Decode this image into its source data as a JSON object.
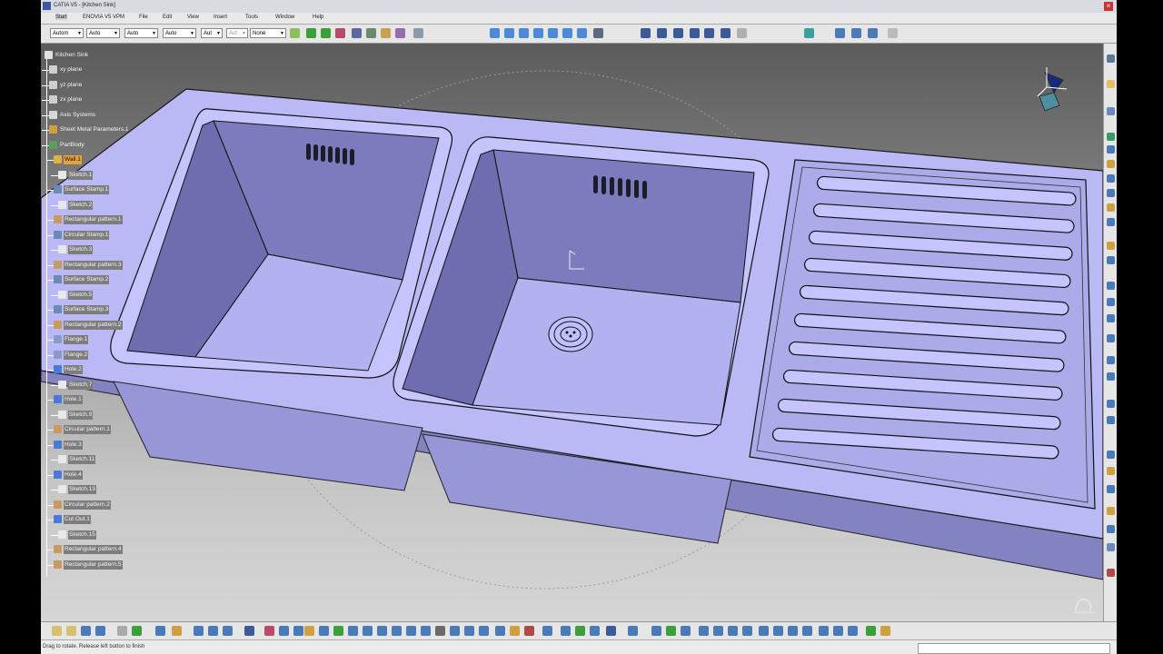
{
  "window": {
    "title": "CATIA V5 - [Kitchen Sink]"
  },
  "menu": {
    "items": [
      "Start",
      "ENOVIA V5 VPM",
      "File",
      "Edit",
      "View",
      "Insert",
      "Tools",
      "Window",
      "Help"
    ]
  },
  "toolbar": {
    "dropdowns": [
      "Autom",
      "Auto",
      "Auto",
      "Auto",
      "Aut",
      "Aut",
      "None"
    ]
  },
  "tree": {
    "root": "Kitchen Sink",
    "items": [
      {
        "label": "xy plane",
        "icon": "plane-icon",
        "style": "plain"
      },
      {
        "label": "yz plane",
        "icon": "plane-icon",
        "style": "plain"
      },
      {
        "label": "zx plane",
        "icon": "plane-icon",
        "style": "plain"
      },
      {
        "label": "Axis Systems",
        "icon": "axis-system-icon",
        "style": "plain"
      },
      {
        "label": "Sheet Metal Parameters.1",
        "icon": "sheet-metal-parameters-icon",
        "style": "plain"
      },
      {
        "label": "PartBody",
        "icon": "partbody-icon",
        "style": "plain"
      },
      {
        "label": "Wall.1",
        "icon": "wall-icon",
        "style": "highlight"
      },
      {
        "label": "Sketch.1",
        "icon": "sketch-icon",
        "style": "box"
      },
      {
        "label": "Surface Stamp.1",
        "icon": "surface-stamp-icon",
        "style": "box"
      },
      {
        "label": "Sketch.2",
        "icon": "sketch-icon",
        "style": "box"
      },
      {
        "label": "Rectangular pattern.1",
        "icon": "rectangular-pattern-icon",
        "style": "box"
      },
      {
        "label": "Circular Stamp.1",
        "icon": "circular-stamp-icon",
        "style": "box"
      },
      {
        "label": "Sketch.3",
        "icon": "sketch-icon",
        "style": "box"
      },
      {
        "label": "Rectangular pattern.3",
        "icon": "rectangular-pattern-icon",
        "style": "box"
      },
      {
        "label": "Surface Stamp.2",
        "icon": "surface-stamp-icon",
        "style": "box"
      },
      {
        "label": "Sketch.5",
        "icon": "sketch-icon",
        "style": "box"
      },
      {
        "label": "Surface Stamp.3",
        "icon": "surface-stamp-icon",
        "style": "box"
      },
      {
        "label": "Rectangular pattern.2",
        "icon": "rectangular-pattern-icon",
        "style": "box"
      },
      {
        "label": "Flange.1",
        "icon": "flange-icon",
        "style": "box"
      },
      {
        "label": "Flange.2",
        "icon": "flange-icon",
        "style": "box"
      },
      {
        "label": "Hole.2",
        "icon": "hole-icon",
        "style": "box"
      },
      {
        "label": "Sketch.7",
        "icon": "sketch-icon",
        "style": "box"
      },
      {
        "label": "Hole.1",
        "icon": "hole-icon",
        "style": "box"
      },
      {
        "label": "Sketch.9",
        "icon": "sketch-icon",
        "style": "box"
      },
      {
        "label": "Circular pattern.1",
        "icon": "circular-pattern-icon",
        "style": "box"
      },
      {
        "label": "Hole.3",
        "icon": "hole-icon",
        "style": "box"
      },
      {
        "label": "Sketch.11",
        "icon": "sketch-icon",
        "style": "box"
      },
      {
        "label": "Hole.4",
        "icon": "hole-icon",
        "style": "box"
      },
      {
        "label": "Sketch.13",
        "icon": "sketch-icon",
        "style": "box"
      },
      {
        "label": "Circular pattern.2",
        "icon": "circular-pattern-icon",
        "style": "box"
      },
      {
        "label": "Cut Out.1",
        "icon": "cut-out-icon",
        "style": "box"
      },
      {
        "label": "Sketch.15",
        "icon": "sketch-icon",
        "style": "box"
      },
      {
        "label": "Rectangular pattern.4",
        "icon": "rectangular-pattern-icon",
        "style": "box"
      },
      {
        "label": "Rectangular pattern.5",
        "icon": "rectangular-pattern-icon",
        "style": "box"
      }
    ]
  },
  "status": {
    "message": "Drag to rotate. Release left button to finish"
  },
  "colors": {
    "highlight": "#e9a13b",
    "model": "#b9b8f4",
    "model_shadow": "#7d7cb8"
  }
}
